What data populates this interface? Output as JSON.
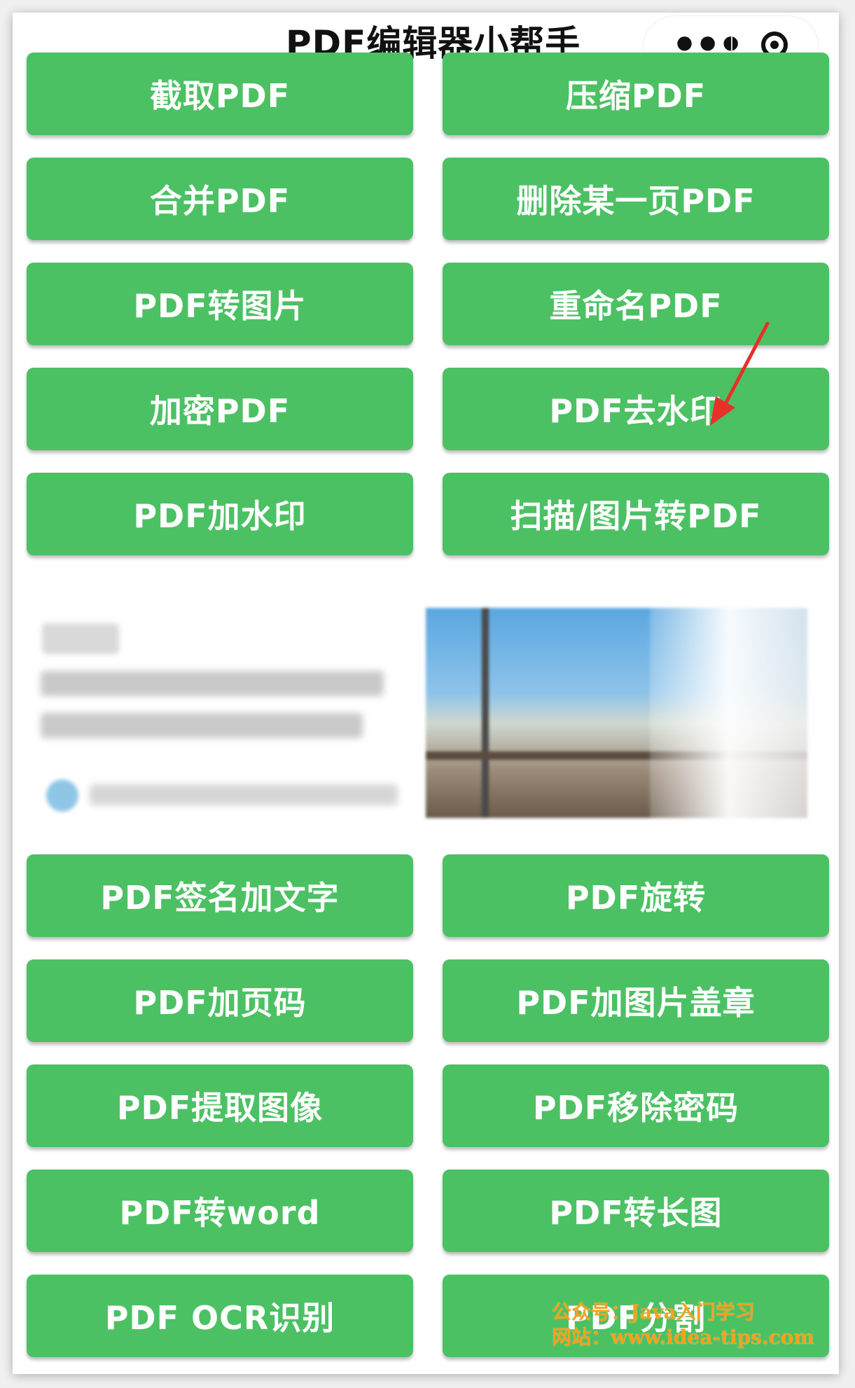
{
  "app": {
    "title": "PDF编辑器小帮手",
    "menu_icon": "more-dots-icon",
    "close_icon": "target-circle-icon"
  },
  "buttons_top": [
    {
      "left": "截取PDF",
      "right": "压缩PDF"
    },
    {
      "left": "合并PDF",
      "right": "删除某一页PDF"
    },
    {
      "left": "PDF转图片",
      "right": "重命名PDF"
    },
    {
      "left": "加密PDF",
      "right": "PDF去水印"
    },
    {
      "left": "PDF加水印",
      "right": "扫描/图片转PDF"
    }
  ],
  "buttons_bottom": [
    {
      "left": "PDF签名加文字",
      "right": "PDF旋转"
    },
    {
      "left": "PDF加页码",
      "right": "PDF加图片盖章"
    },
    {
      "left": "PDF提取图像",
      "right": "PDF移除密码"
    },
    {
      "left": "PDF转word",
      "right": "PDF转长图"
    },
    {
      "left": "PDF OCR识别",
      "right": "PDF分割"
    }
  ],
  "watermark": {
    "line1": "公众号：Java入门学习",
    "line2": "网站：www.idea-tips.com"
  },
  "colors": {
    "button_bg": "#4cc164",
    "button_text": "#ffffff",
    "arrow": "#e8302a",
    "watermark": "#f4a21c"
  }
}
